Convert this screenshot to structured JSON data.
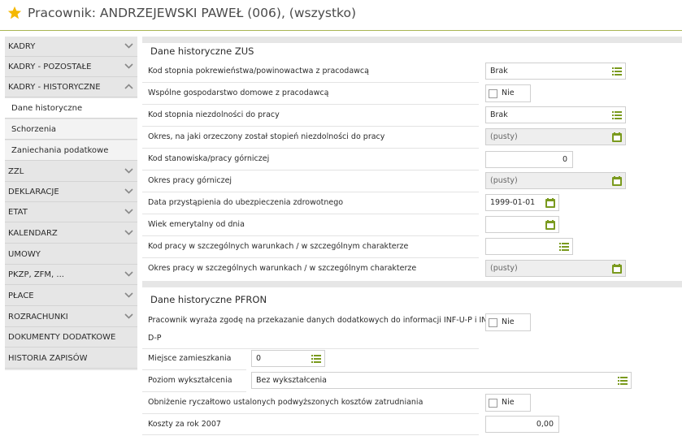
{
  "header": {
    "title": "Pracownik: ANDRZEJEWSKI PAWEŁ (006), (wszystko)"
  },
  "colors": {
    "accent": "#a9b553",
    "star": "#f5b800",
    "icon_green": "#7a9a1e"
  },
  "sidebar": {
    "items": [
      {
        "label": "KADRY",
        "chevron": "down"
      },
      {
        "label": "KADRY - POZOSTAŁE",
        "chevron": "down"
      },
      {
        "label": "KADRY - HISTORYCZNE",
        "chevron": "up"
      },
      {
        "label": "Dane historyczne",
        "sub": true,
        "active": true
      },
      {
        "label": "Schorzenia",
        "sub": true
      },
      {
        "label": "Zaniechania podatkowe",
        "sub": true
      },
      {
        "label": "ZZL",
        "chevron": "down"
      },
      {
        "label": "DEKLARACJE",
        "chevron": "down"
      },
      {
        "label": "ETAT",
        "chevron": "down"
      },
      {
        "label": "KALENDARZ",
        "chevron": "down"
      },
      {
        "label": "UMOWY"
      },
      {
        "label": "PKZP, ZFM, ...",
        "chevron": "down"
      },
      {
        "label": "PŁACE",
        "chevron": "down"
      },
      {
        "label": "ROZRACHUNKI",
        "chevron": "down"
      },
      {
        "label": "DOKUMENTY DODATKOWE"
      },
      {
        "label": "HISTORIA ZAPISÓW"
      }
    ]
  },
  "zus": {
    "title": "Dane historyczne ZUS",
    "rows": [
      {
        "label": "Kod stopnia pokrewieństwa/powinowactwa z pracodawcą",
        "value": "Brak",
        "icon": "list-icon"
      },
      {
        "label": "Wspólne gospodarstwo domowe z pracodawcą",
        "checkbox": "Nie"
      },
      {
        "label": "Kod stopnia niezdolności do pracy",
        "value": "Brak",
        "icon": "list-icon"
      },
      {
        "label": "Okres, na jaki orzeczony został stopień niezdolności do pracy",
        "value": "(pusty)",
        "icon": "calendar-icon"
      },
      {
        "label": "Kod stanowiska/pracy górniczej",
        "value": "0"
      },
      {
        "label": "Okres pracy górniczej",
        "value": "(pusty)",
        "icon": "calendar-icon"
      },
      {
        "label": "Data przystąpienia do ubezpieczenia zdrowotnego",
        "value": "1999-01-01",
        "icon": "calendar-icon"
      },
      {
        "label": "Wiek emerytalny od dnia",
        "value": "",
        "icon": "calendar-icon"
      },
      {
        "label": "Kod pracy w szczególnych warunkach / w szczególnym charakterze",
        "value": "",
        "icon": "list-icon"
      },
      {
        "label": "Okres pracy w szczególnych warunkach / w szczególnym charakterze",
        "value": "(pusty)",
        "icon": "calendar-icon"
      }
    ]
  },
  "pfron": {
    "title": "Dane historyczne PFRON",
    "rows": [
      {
        "label_line1": "Pracownik wyraża zgodę na przekazanie danych dodatkowych do informacji INF-U-P i INF-",
        "label_line2": "D-P",
        "checkbox": "Nie"
      },
      {
        "label": "Miejsce zamieszkania",
        "value": "0",
        "icon": "list-icon"
      },
      {
        "label": "Poziom wykształcenia",
        "value": "Bez wykształcenia",
        "icon": "list-icon"
      },
      {
        "label": "Obniżenie ryczałtowo ustalonych podwyższonych kosztów zatrudniania",
        "checkbox": "Nie"
      },
      {
        "label": "Koszty za rok 2007",
        "value": "0,00"
      }
    ]
  }
}
